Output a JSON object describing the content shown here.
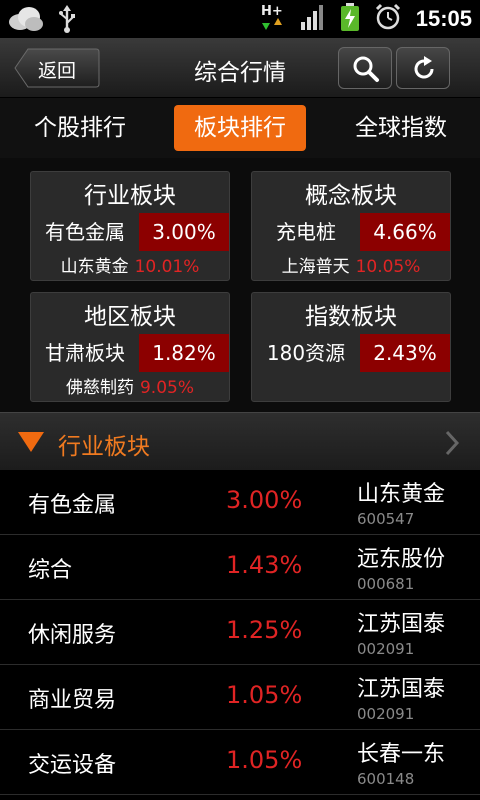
{
  "status_bar": {
    "time": "15:05",
    "icons": [
      "weather-cloud-icon",
      "usb-icon",
      "hspa-data-icon",
      "signal-icon",
      "battery-charging-icon",
      "alarm-icon"
    ],
    "network_label": "H+"
  },
  "header": {
    "back_label": "返回",
    "title": "综合行情",
    "actions": [
      "search-icon",
      "refresh-icon"
    ]
  },
  "tabs": [
    {
      "label": "个股排行",
      "active": false
    },
    {
      "label": "板块排行",
      "active": true
    },
    {
      "label": "全球指数",
      "active": false
    }
  ],
  "sector_cards": [
    {
      "title": "行业板块",
      "sector": "有色金属",
      "change": "3.00%",
      "leader": "山东黄金",
      "leader_change": "10.01%"
    },
    {
      "title": "概念板块",
      "sector": "充电桩",
      "change": "4.66%",
      "leader": "上海普天",
      "leader_change": "10.05%"
    },
    {
      "title": "地区板块",
      "sector": "甘肃板块",
      "change": "1.82%",
      "leader": "佛慈制药",
      "leader_change": "9.05%"
    },
    {
      "title": "指数板块",
      "sector": "180资源",
      "change": "2.43%",
      "leader": "",
      "leader_change": ""
    }
  ],
  "section": {
    "title": "行业板块"
  },
  "rows": [
    {
      "name": "有色金属",
      "change": "3.00%",
      "stock": "山东黄金",
      "code": "600547"
    },
    {
      "name": "综合",
      "change": "1.43%",
      "stock": "远东股份",
      "code": "000681"
    },
    {
      "name": "休闲服务",
      "change": "1.25%",
      "stock": "江苏国泰",
      "code": "002091"
    },
    {
      "name": "商业贸易",
      "change": "1.05%",
      "stock": "江苏国泰",
      "code": "002091"
    },
    {
      "name": "交运设备",
      "change": "1.05%",
      "stock": "长春一东",
      "code": "600148"
    }
  ],
  "colors": {
    "accent": "#f06a10",
    "up": "#e02424",
    "up_bg": "#8c0000",
    "section_title": "#f07a20"
  }
}
